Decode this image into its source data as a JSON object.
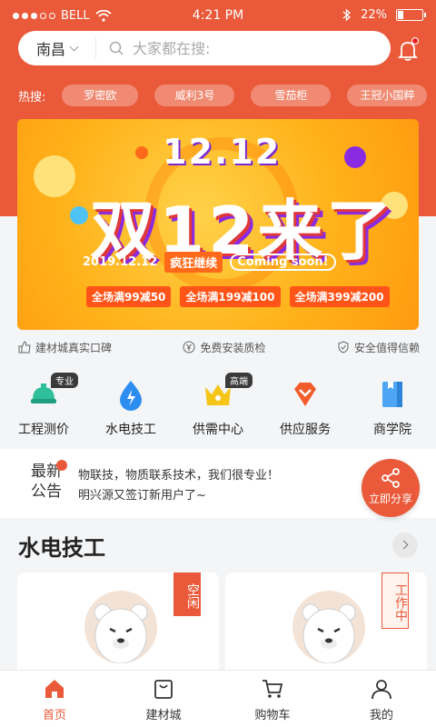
{
  "status_bar": {
    "carrier": "BELL",
    "time": "4:21 PM",
    "battery": "22%",
    "battery_level": 0.22
  },
  "search": {
    "city": "南昌",
    "placeholder": "大家都在搜:"
  },
  "hot_search": {
    "label": "热搜:",
    "items": [
      "罗密欧",
      "威利3号",
      "雪茄柜",
      "王冠小国粹"
    ]
  },
  "banner": {
    "date_big": "12.12",
    "headline": "双12来了",
    "date_line": "2019.12.12",
    "tag": "疯狂继续",
    "coming": "Coming soon!",
    "promos": [
      "全场满99减50",
      "全场满199减100",
      "全场满399减200"
    ]
  },
  "guarantees": [
    "建材城真实口碑",
    "免费安装质检",
    "安全值得信赖"
  ],
  "categories": [
    {
      "label": "工程测价",
      "badge": "专业",
      "icon": "helmet-icon"
    },
    {
      "label": "水电技工",
      "badge": "",
      "icon": "water-drop-icon"
    },
    {
      "label": "供需中心",
      "badge": "高端",
      "icon": "crown-icon"
    },
    {
      "label": "供应服务",
      "badge": "",
      "icon": "diamond-icon"
    },
    {
      "label": "商学院",
      "badge": "",
      "icon": "book-icon"
    }
  ],
  "notice": {
    "title": "最新公告",
    "lines": [
      "物联技，物质联系技术，我们很专业！",
      "明兴源又签订新用户了~"
    ]
  },
  "share": {
    "label": "立即分享"
  },
  "section": {
    "title": "水电技工"
  },
  "workers": [
    {
      "status": "空闲",
      "filled": true
    },
    {
      "status": "工作中",
      "filled": false
    }
  ],
  "tabbar": [
    {
      "label": "首页",
      "icon": "home-icon",
      "active": true
    },
    {
      "label": "建材城",
      "icon": "shopping-bag-icon",
      "active": false
    },
    {
      "label": "购物车",
      "icon": "cart-icon",
      "active": false
    },
    {
      "label": "我的",
      "icon": "user-icon",
      "active": false
    }
  ],
  "colors": {
    "brand": "#ea5a3a",
    "banner": "#ffb21a"
  }
}
